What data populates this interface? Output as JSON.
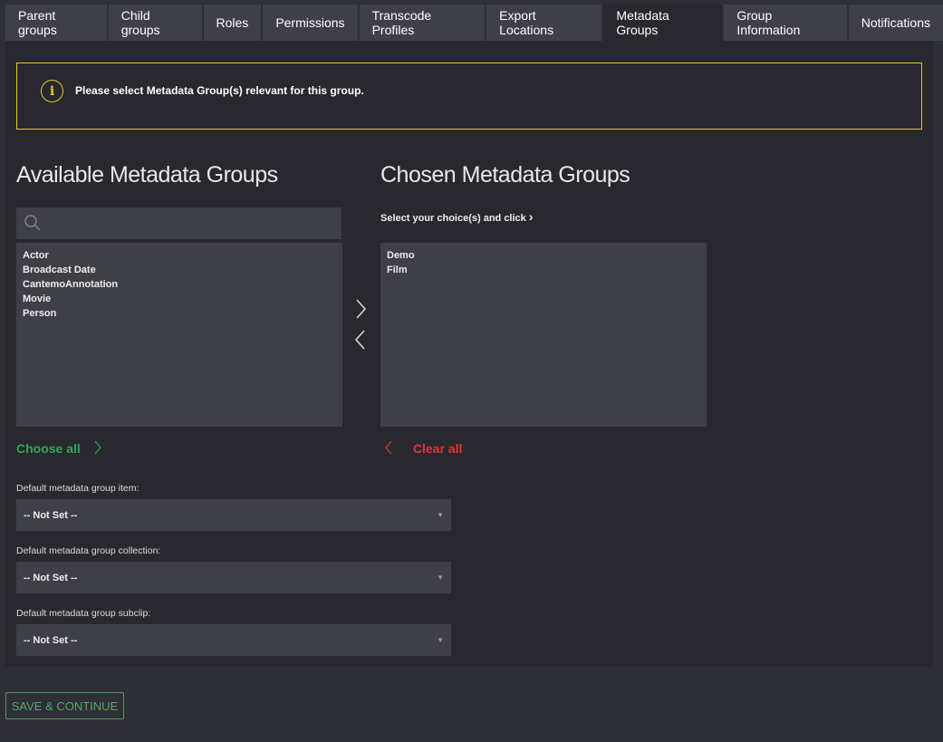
{
  "tabs": [
    {
      "label": "Parent groups"
    },
    {
      "label": "Child groups"
    },
    {
      "label": "Roles"
    },
    {
      "label": "Permissions"
    },
    {
      "label": "Transcode Profiles"
    },
    {
      "label": "Export Locations"
    },
    {
      "label": "Metadata Groups",
      "active": true
    },
    {
      "label": "Group Information"
    },
    {
      "label": "Notifications"
    }
  ],
  "alert": {
    "icon": "info-icon",
    "message": "Please select Metadata Group(s) relevant for this group.",
    "color": "#e3cd2a"
  },
  "available": {
    "title": "Available Metadata Groups",
    "search_placeholder": "",
    "items": [
      "Actor",
      "Broadcast Date",
      "CantemoAnnotation",
      "Movie",
      "Person"
    ],
    "choose_all": "Choose all"
  },
  "chosen": {
    "title": "Chosen Metadata Groups",
    "hint": "Select your choice(s) and click",
    "items": [
      "Demo",
      "Film"
    ],
    "clear_all": "Clear all"
  },
  "defaults": [
    {
      "label": "Default metadata group item:",
      "value": "-- Not Set --"
    },
    {
      "label": "Default metadata group collection:",
      "value": "-- Not Set --"
    },
    {
      "label": "Default metadata group subclip:",
      "value": "-- Not Set --"
    }
  ],
  "save_label": "SAVE & CONTINUE",
  "colors": {
    "choose": "#2fa855",
    "clear": "#e8323c",
    "save": "#5aa866"
  }
}
